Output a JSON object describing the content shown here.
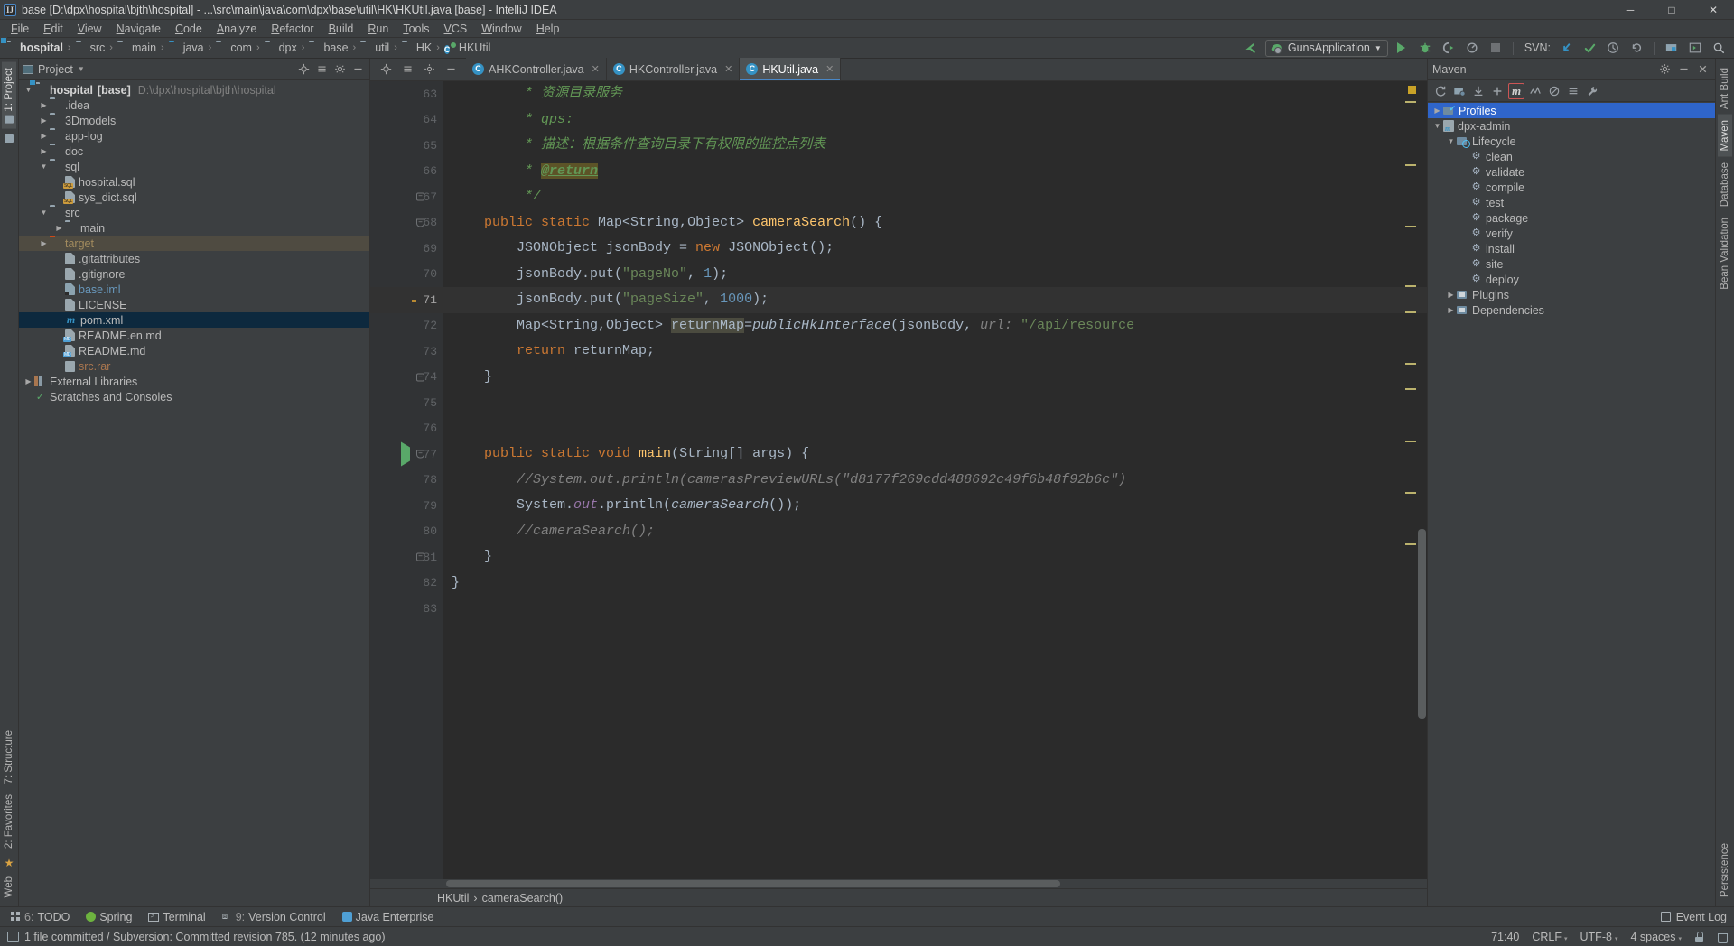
{
  "window": {
    "title": "base [D:\\dpx\\hospital\\bjth\\hospital] - ...\\src\\main\\java\\com\\dpx\\base\\util\\HK\\HKUtil.java [base] - IntelliJ IDEA",
    "minimize": "─",
    "maximize": "□",
    "close": "✕"
  },
  "menu": [
    "File",
    "Edit",
    "View",
    "Navigate",
    "Code",
    "Analyze",
    "Refactor",
    "Build",
    "Run",
    "Tools",
    "VCS",
    "Window",
    "Help"
  ],
  "breadcrumb": [
    {
      "label": "hospital",
      "icon": "module-folder-icon",
      "bold": true
    },
    {
      "label": "src",
      "icon": "folder-icon",
      "bold": false
    },
    {
      "label": "main",
      "icon": "folder-icon",
      "bold": false
    },
    {
      "label": "java",
      "icon": "source-folder-icon",
      "bold": false
    },
    {
      "label": "com",
      "icon": "package-folder-icon",
      "bold": false
    },
    {
      "label": "dpx",
      "icon": "package-folder-icon",
      "bold": false
    },
    {
      "label": "base",
      "icon": "package-folder-icon",
      "bold": false
    },
    {
      "label": "util",
      "icon": "package-folder-icon",
      "bold": false
    },
    {
      "label": "HK",
      "icon": "package-folder-icon",
      "bold": false
    },
    {
      "label": "HKUtil",
      "icon": "java-class-icon",
      "bold": false
    }
  ],
  "toolbar": {
    "back_arrow_icon": "back-arrow-icon",
    "run_config_name": "GunsApplication",
    "run_icon": "run-icon",
    "debug_icon": "debug-icon",
    "coverage_icon": "run-with-coverage-icon",
    "profile_icon": "profile-icon",
    "stop_icon": "stop-icon",
    "svn_label": "SVN:",
    "svn_update_icon": "svn-update-icon",
    "svn_commit_icon": "svn-commit-icon",
    "svn_history_icon": "svn-history-icon",
    "svn_rollback_icon": "svn-rollback-icon",
    "project_structure_icon": "project-structure-icon",
    "settings_icon": "settings-icon",
    "search_icon": "search-icon"
  },
  "left_strip": [
    {
      "label": "1: Project",
      "active": true,
      "icon": "project-icon"
    },
    {
      "label": "",
      "active": false,
      "icon": "favorites-folder-icon"
    }
  ],
  "left_strip_bottom": [
    {
      "label": "7: Structure",
      "icon": "structure-icon"
    },
    {
      "label": "2: Favorites",
      "icon": "star-icon"
    },
    {
      "label": "Web",
      "icon": "web-icon"
    }
  ],
  "right_strip": [
    {
      "label": "Ant Build",
      "icon": "ant-icon"
    },
    {
      "label": "Maven",
      "icon": "maven-icon"
    },
    {
      "label": "Database",
      "icon": "database-icon"
    },
    {
      "label": "Bean Validation",
      "icon": "bean-icon"
    }
  ],
  "right_strip_bottom": [
    {
      "label": "Persistence",
      "icon": "persistence-icon"
    }
  ],
  "project_panel": {
    "title": "Project",
    "locate_icon": "locate-icon",
    "collapse_icon": "collapse-all-icon",
    "settings_icon": "gear-icon",
    "hide_icon": "hide-icon",
    "tree": [
      {
        "label": "hospital",
        "suffix": "[base]",
        "path": "D:\\dpx\\hospital\\bjth\\hospital",
        "indent": 0,
        "arrow": "down",
        "icon": "module-folder-icon",
        "style": "bold"
      },
      {
        "label": ".idea",
        "indent": 1,
        "arrow": "right",
        "icon": "folder-icon",
        "style": ""
      },
      {
        "label": "3Dmodels",
        "indent": 1,
        "arrow": "right",
        "icon": "folder-icon",
        "style": ""
      },
      {
        "label": "app-log",
        "indent": 1,
        "arrow": "right",
        "icon": "folder-icon",
        "style": ""
      },
      {
        "label": "doc",
        "indent": 1,
        "arrow": "right",
        "icon": "folder-icon",
        "style": ""
      },
      {
        "label": "sql",
        "indent": 1,
        "arrow": "down",
        "icon": "folder-icon",
        "style": ""
      },
      {
        "label": "hospital.sql",
        "indent": 2,
        "arrow": "",
        "icon": "sql-file-icon",
        "style": ""
      },
      {
        "label": "sys_dict.sql",
        "indent": 2,
        "arrow": "",
        "icon": "sql-file-icon",
        "style": ""
      },
      {
        "label": "src",
        "indent": 1,
        "arrow": "down",
        "icon": "folder-icon",
        "style": ""
      },
      {
        "label": "main",
        "indent": 2,
        "arrow": "right",
        "icon": "folder-icon",
        "style": ""
      },
      {
        "label": "target",
        "indent": 1,
        "arrow": "right",
        "icon": "excluded-folder-icon",
        "style": "target",
        "row": "sel-olive"
      },
      {
        "label": ".gitattributes",
        "indent": 2,
        "arrow": "",
        "icon": "text-file-icon",
        "style": ""
      },
      {
        "label": ".gitignore",
        "indent": 2,
        "arrow": "",
        "icon": "text-file-icon",
        "style": ""
      },
      {
        "label": "base.iml",
        "indent": 2,
        "arrow": "",
        "icon": "iml-file-icon",
        "style": "blue"
      },
      {
        "label": "LICENSE",
        "indent": 2,
        "arrow": "",
        "icon": "text-file-icon",
        "style": ""
      },
      {
        "label": "pom.xml",
        "indent": 2,
        "arrow": "",
        "icon": "maven-pom-icon",
        "style": "",
        "row": "sel-blue"
      },
      {
        "label": "README.en.md",
        "indent": 2,
        "arrow": "",
        "icon": "markdown-file-icon",
        "style": ""
      },
      {
        "label": "README.md",
        "indent": 2,
        "arrow": "",
        "icon": "markdown-file-icon",
        "style": ""
      },
      {
        "label": "src.rar",
        "indent": 2,
        "arrow": "",
        "icon": "archive-file-icon",
        "style": "brown"
      },
      {
        "label": "External Libraries",
        "indent": 0,
        "arrow": "right",
        "icon": "library-icon",
        "style": ""
      },
      {
        "label": "Scratches and Consoles",
        "indent": 0,
        "arrow": "",
        "icon": "scratches-icon",
        "style": ""
      }
    ]
  },
  "editor": {
    "tabs": [
      {
        "label": "AHKController.java",
        "active": false,
        "icon": "java-class-icon",
        "close": "✕"
      },
      {
        "label": "HKController.java",
        "active": false,
        "icon": "java-class-icon",
        "close": "✕"
      },
      {
        "label": "HKUtil.java",
        "active": true,
        "icon": "java-class-icon",
        "close": "✕"
      }
    ],
    "first_line_number": 63,
    "lines": [
      {
        "n": 63,
        "gutter": "",
        "fold": "",
        "html": "         <span class='c-cmt'>* 资源目录服务</span>"
      },
      {
        "n": 64,
        "gutter": "",
        "fold": "",
        "html": "         <span class='c-cmt'>* qps:</span>"
      },
      {
        "n": 65,
        "gutter": "",
        "fold": "",
        "html": "         <span class='c-cmt'>* 描述：根据条件查询目录下有权限的监控点列表</span>"
      },
      {
        "n": 66,
        "gutter": "",
        "fold": "",
        "html": "         <span class='c-cmt'>* </span><span class='c-tagret'>@return</span>"
      },
      {
        "n": 67,
        "gutter": "",
        "fold": "round",
        "html": "         <span class='c-cmt'>*/</span>"
      },
      {
        "n": 68,
        "gutter": "",
        "fold": "down",
        "html": "    <span class='c-kw'>public static </span>Map&lt;String,Object&gt; <span class='c-meth'>cameraSearch</span>() {"
      },
      {
        "n": 69,
        "gutter": "",
        "fold": "",
        "html": "        JSONObject jsonBody = <span class='c-kw'>new </span>JSONObject();"
      },
      {
        "n": 70,
        "gutter": "",
        "fold": "",
        "html": "        jsonBody.put(<span class='c-str'>\"pageNo\"</span>, <span class='c-num'>1</span>);"
      },
      {
        "n": 71,
        "gutter": "bulb",
        "fold": "",
        "cur": true,
        "html": "        jsonBody.put(<span class='c-str'>\"pageSize\"</span>, <span class='c-num'>1000</span>);<span class='caret-bar'></span>"
      },
      {
        "n": 72,
        "gutter": "",
        "fold": "",
        "html": "        Map&lt;String,Object&gt; <span class='c-ident-hl'>returnMap</span>=<span class='c-static'>publicHkInterface</span>(jsonBody, <span class='c-hint'>url: </span><span class='c-str'>\"/api/resource</span>"
      },
      {
        "n": 73,
        "gutter": "",
        "fold": "",
        "html": "        <span class='c-kw'>return </span>returnMap;"
      },
      {
        "n": 74,
        "gutter": "",
        "fold": "round",
        "html": "    }"
      },
      {
        "n": 75,
        "gutter": "",
        "fold": "",
        "html": ""
      },
      {
        "n": 76,
        "gutter": "",
        "fold": "",
        "html": ""
      },
      {
        "n": 77,
        "gutter": "run",
        "fold": "down",
        "html": "    <span class='c-kw'>public static void </span><span class='c-meth'>main</span>(String[] args) {"
      },
      {
        "n": 78,
        "gutter": "",
        "fold": "",
        "html": "        <span class='c-cmt2'>//System.out.println(camerasPreviewURLs(\"d8177f269cdd488692c49f6b48f92b6c\")</span>"
      },
      {
        "n": 79,
        "gutter": "",
        "fold": "",
        "html": "        System.<span class='c-field'>out</span>.println(<span class='c-static'>cameraSearch</span>());"
      },
      {
        "n": 80,
        "gutter": "",
        "fold": "",
        "html": "        <span class='c-cmt2'>//cameraSearch();</span>"
      },
      {
        "n": 81,
        "gutter": "",
        "fold": "round",
        "html": "    }"
      },
      {
        "n": 82,
        "gutter": "",
        "fold": "",
        "html": "}"
      },
      {
        "n": 83,
        "gutter": "",
        "fold": "",
        "html": ""
      }
    ],
    "breadcrumbs": [
      "HKUtil",
      "cameraSearch()"
    ],
    "breadcrumb_sep": "›"
  },
  "maven_panel": {
    "title": "Maven",
    "settings_icon": "gear-icon",
    "hide_icon": "hide-icon",
    "close_icon": "close-icon",
    "toolbar": [
      {
        "icon": "reimport-icon",
        "label": "↻"
      },
      {
        "icon": "generate-sources-icon",
        "label": "⎘"
      },
      {
        "icon": "download-sources-icon",
        "label": "⤓"
      },
      {
        "icon": "add-maven-project-icon",
        "label": "+"
      },
      {
        "icon": "run-maven-goal-icon",
        "label": "m",
        "highlighted": true
      },
      {
        "icon": "toggle-offline-icon",
        "label": "⤨"
      },
      {
        "icon": "toggle-skip-tests-icon",
        "label": "⊘"
      },
      {
        "icon": "collapse-all-icon",
        "label": "≡"
      },
      {
        "icon": "maven-settings-icon",
        "label": "🔧"
      }
    ],
    "tree": [
      {
        "label": "Profiles",
        "indent": 0,
        "arrow": "right",
        "icon": "profiles-icon",
        "selected": true
      },
      {
        "label": "dpx-admin",
        "indent": 0,
        "arrow": "down",
        "icon": "maven-module-icon",
        "selected": false
      },
      {
        "label": "Lifecycle",
        "indent": 1,
        "arrow": "down",
        "icon": "lifecycle-folder-icon",
        "selected": false
      },
      {
        "label": "clean",
        "indent": 2,
        "arrow": "",
        "icon": "maven-goal-icon",
        "selected": false
      },
      {
        "label": "validate",
        "indent": 2,
        "arrow": "",
        "icon": "maven-goal-icon",
        "selected": false
      },
      {
        "label": "compile",
        "indent": 2,
        "arrow": "",
        "icon": "maven-goal-icon",
        "selected": false
      },
      {
        "label": "test",
        "indent": 2,
        "arrow": "",
        "icon": "maven-goal-icon",
        "selected": false
      },
      {
        "label": "package",
        "indent": 2,
        "arrow": "",
        "icon": "maven-goal-icon",
        "selected": false
      },
      {
        "label": "verify",
        "indent": 2,
        "arrow": "",
        "icon": "maven-goal-icon",
        "selected": false
      },
      {
        "label": "install",
        "indent": 2,
        "arrow": "",
        "icon": "maven-goal-icon",
        "selected": false
      },
      {
        "label": "site",
        "indent": 2,
        "arrow": "",
        "icon": "maven-goal-icon",
        "selected": false
      },
      {
        "label": "deploy",
        "indent": 2,
        "arrow": "",
        "icon": "maven-goal-icon",
        "selected": false
      },
      {
        "label": "Plugins",
        "indent": 1,
        "arrow": "right",
        "icon": "plugins-folder-icon",
        "selected": false
      },
      {
        "label": "Dependencies",
        "indent": 1,
        "arrow": "right",
        "icon": "dependencies-folder-icon",
        "selected": false
      }
    ]
  },
  "bottom_bar": {
    "items": [
      {
        "num": "6:",
        "label": "TODO",
        "icon": "todo-icon"
      },
      {
        "num": "",
        "label": "Spring",
        "icon": "spring-icon"
      },
      {
        "num": "",
        "label": "Terminal",
        "icon": "terminal-icon"
      },
      {
        "num": "9:",
        "label": "Version Control",
        "icon": "version-control-icon"
      },
      {
        "num": "",
        "label": "Java Enterprise",
        "icon": "java-enterprise-icon"
      }
    ],
    "event_log": "Event Log",
    "event_log_icon": "event-log-icon"
  },
  "status_bar": {
    "message": "1 file committed / Subversion: Committed revision 785. (12 minutes ago)",
    "message_icon": "commit-info-icon",
    "caret_position": "71:40",
    "line_separator": "CRLF",
    "encoding": "UTF-8",
    "indent": "4 spaces",
    "lock_icon": "lock-icon",
    "trash_icon": "trash-icon"
  }
}
